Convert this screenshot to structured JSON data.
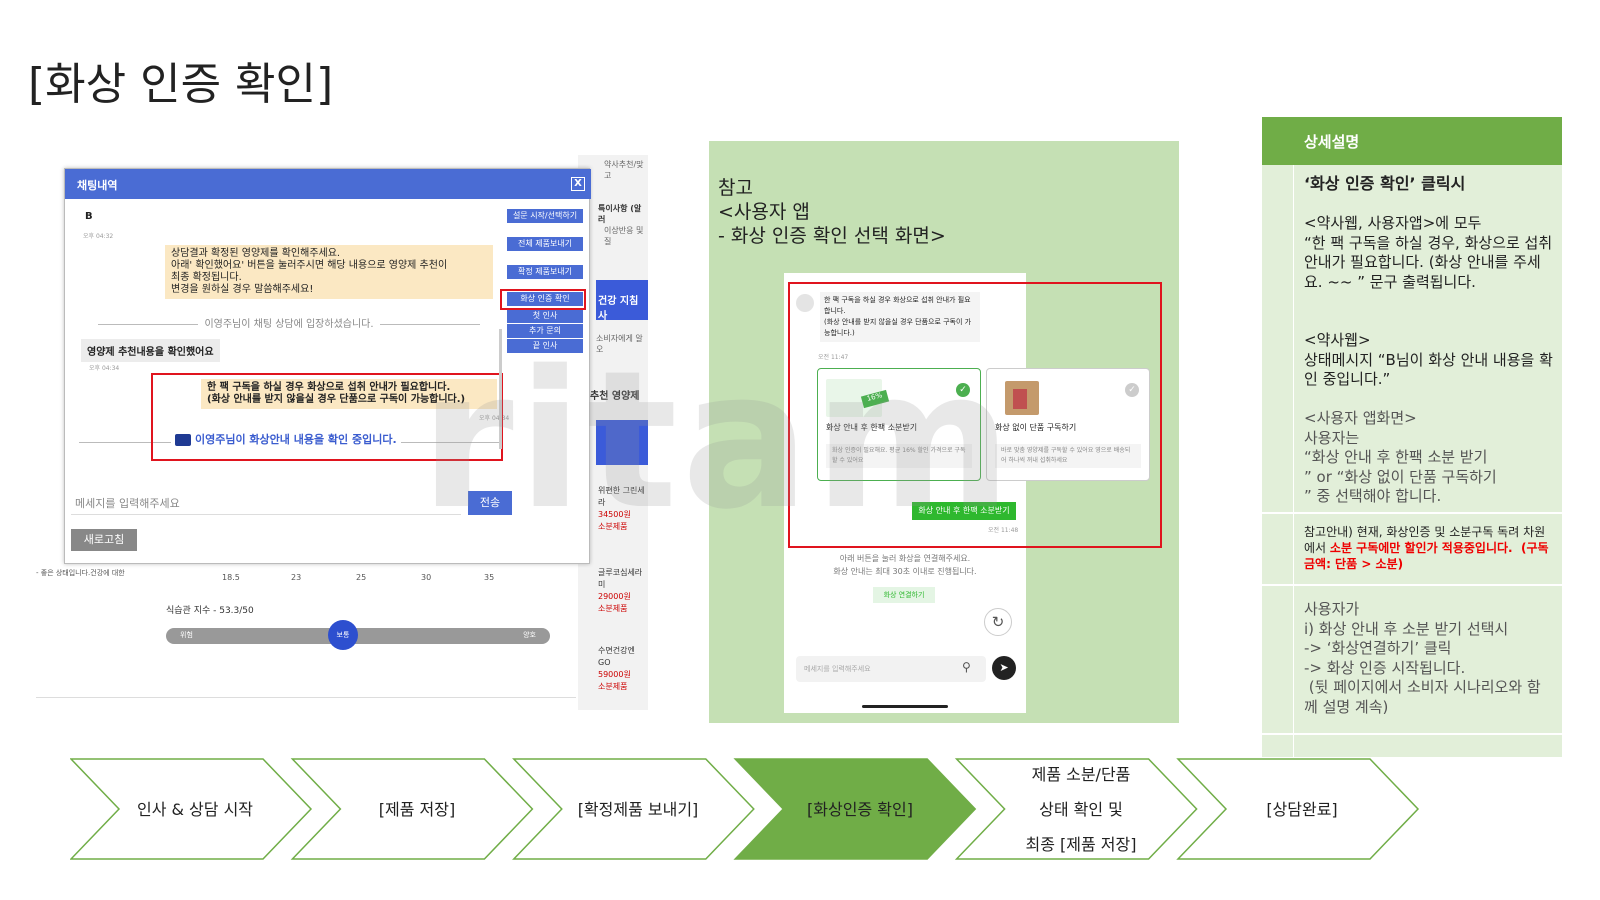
{
  "title": "[화상 인증 확인]",
  "admin": {
    "bg": {
      "side_texts": [
        "약사추천/맞고",
        "특이사항 (알러",
        "이상반응 및 질",
        "건강 지침사",
        "소비자에게 알오",
        "추천 영양제"
      ],
      "products": [
        {
          "name": "위편한 그린세라",
          "price": "34500원",
          "tag": "소분제품"
        },
        {
          "name": "글루코심세라미",
          "price": "29000원",
          "tag": "소분제품"
        },
        {
          "name": "수면건강엔 GO",
          "price": "59000원",
          "tag": "소분제품"
        }
      ],
      "left_note": "- 좋은 상태입니다.건강에 대한",
      "axis": [
        "18.5",
        "23",
        "25",
        "30",
        "35"
      ],
      "habit_score": "식습관 지수 - 53.3/50",
      "slider": {
        "left": "위험",
        "knob": "보통",
        "right": "양호",
        "value_pct": 46
      }
    },
    "chat": {
      "title": "채팅내역",
      "close": "X",
      "user_initial": "B",
      "time1": "오후 04:32",
      "bubble1": "상담결과 확정된 영양제를 확인해주세요.\n아래' 확인했어요' 버튼을 눌러주시면 해당 내용으로 영양제 추천이\n최종 확정됩니다.\n변경을 원하실 경우 말씀해주세요!",
      "enter_msg": "이영주님이 채팅 상담에 입장하셨습니다.",
      "user_msg": "영양제 추천내용을 확인했어요",
      "time2": "오후 04:34",
      "bubble2": "한 팩 구독을 하실 경우 화상으로 섭취 안내가 필요합니다.\n(화상 안내를 받지 않을실 경우 단품으로 구독이 가능합니다.)",
      "time3": "오후 04:34",
      "status_msg": "이영주님이 화상안내 내용을 확인 중입니다.",
      "side_buttons": [
        "설문 시작/선택하기",
        "전체 제품보내기",
        "확정 제품보내기",
        "화상 인증 확인",
        "첫 인사",
        "추가 문의",
        "끝 인사"
      ],
      "input_placeholder": "메세지를 입력해주세요",
      "send": "전송",
      "refresh": "새로고침"
    }
  },
  "reference": {
    "label": "참고\n<사용자 앱\n- 화상 인증 확인 선택 화면>",
    "phone": {
      "msg": "한 팩 구독을 하실 경우 화상으로 섭취 안내가 필요합니다.\n(화상 안내를 받지 않을실 경우 단품으로 구독이 가능합니다.)",
      "time1": "오전 11:47",
      "option1_title": "화상 안내 후 한팩 소분받기",
      "option1_desc": "화상 인증이 필요해요. 평균 16% 할인 가격으로 구독 할 수 있어요",
      "option1_badge": "16%",
      "option2_title": "화상 없이 단품 구독하기",
      "option2_desc": "바로 맞춤 영양제를 구독할 수 있어요 영으로 배송되어 하나씩 꺼내 섭취하세요",
      "reply": "화상 안내 후 한팩 소분받기",
      "time2": "오전 11:48",
      "note": "아래 버튼을 눌러 화상을 연결해주세요.\n화상 안내는 최대 30초 이내로 진행됩니다.",
      "connect": "화상 연결하기",
      "input_placeholder": "메세지를 입력해주세요"
    }
  },
  "watermark": "ritam",
  "description": {
    "header": "상세설명",
    "block1_title": "‘화상 인증 확인’ 클릭시",
    "block1_p1": "<약사웹, 사용자앱>에 모두\n“한 팩 구독을 하실 경우, 화상으로 섭취 안내가 필요합니다. (화상 안내를 주세요. ~~ ” 문구 출력됩니다.",
    "block1_p2": "<약사웹>\n상태메시지 “B님이 화상 안내 내용을 확인 중입니다.”",
    "block1_p3": "<사용자 앱화면>\n사용자는\n“화상 안내 후 한팩 소분 받기\n” or “화상 없이 단품 구독하기\n” 중 선택해야 합니다.",
    "block2_a": "참고안내) 현재, 화상인증 및 소분구독 독려 차원에서 ",
    "block2_b": "소분 구독에만 할인가 적용중입니다.  (구독 금액: 단품 > 소분)",
    "block3": "사용자가\ni) 화상 안내 후 소분 받기 선택시\n-> ‘화상연결하기’ 클릭\n-> 화상 인증 시작됩니다.\n (뒷 페이지에서 소비자 시나리오와 함께 설명 계속)"
  },
  "flow": {
    "steps": [
      "인사 & 상담 시작",
      "[제품 저장]",
      "[확정제품 보내기]",
      "[화상인증 확인]",
      "제품 소분/단품\n상태 확인 및\n최종 [제품 저장]",
      "[상담완료]"
    ],
    "active_index": 3,
    "colors": {
      "active": "#70ad47",
      "outline": "#70ad47"
    }
  }
}
